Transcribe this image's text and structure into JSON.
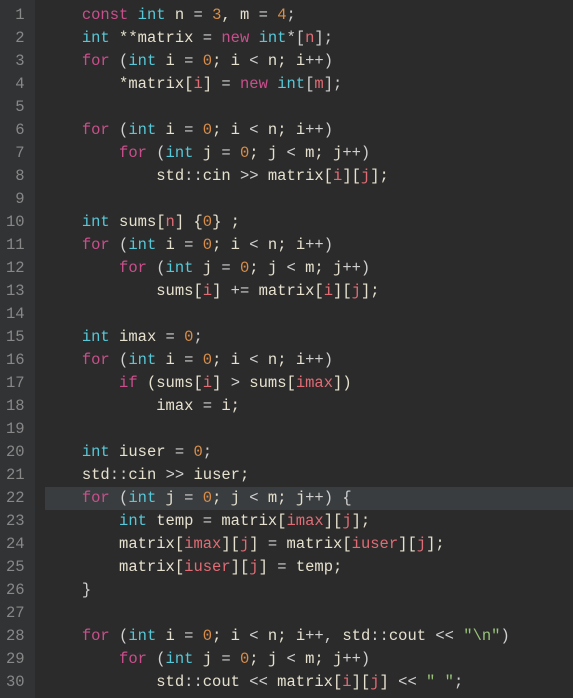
{
  "code": {
    "language": "cpp",
    "line_count": 30,
    "current_line": 22,
    "lines": [
      {
        "n": 1,
        "indent": 1,
        "tokens": [
          {
            "t": "const ",
            "c": "kw"
          },
          {
            "t": "int",
            "c": "type"
          },
          {
            "t": " n ",
            "c": "id"
          },
          {
            "t": "= ",
            "c": "op"
          },
          {
            "t": "3",
            "c": "num"
          },
          {
            "t": ", m ",
            "c": "id"
          },
          {
            "t": "= ",
            "c": "op"
          },
          {
            "t": "4",
            "c": "num"
          },
          {
            "t": ";",
            "c": "op"
          }
        ]
      },
      {
        "n": 2,
        "indent": 1,
        "tokens": [
          {
            "t": "int",
            "c": "type"
          },
          {
            "t": " **matrix ",
            "c": "id"
          },
          {
            "t": "= ",
            "c": "op"
          },
          {
            "t": "new ",
            "c": "kw"
          },
          {
            "t": "int",
            "c": "type"
          },
          {
            "t": "*[",
            "c": "op"
          },
          {
            "t": "n",
            "c": "mid"
          },
          {
            "t": "];",
            "c": "op"
          }
        ]
      },
      {
        "n": 3,
        "indent": 1,
        "tokens": [
          {
            "t": "for",
            "c": "kw"
          },
          {
            "t": " (",
            "c": "op"
          },
          {
            "t": "int",
            "c": "type"
          },
          {
            "t": " i ",
            "c": "id"
          },
          {
            "t": "= ",
            "c": "op"
          },
          {
            "t": "0",
            "c": "num"
          },
          {
            "t": "; i ",
            "c": "id"
          },
          {
            "t": "< ",
            "c": "op"
          },
          {
            "t": "n",
            "c": "id"
          },
          {
            "t": "; i",
            "c": "id"
          },
          {
            "t": "++)",
            "c": "op"
          }
        ]
      },
      {
        "n": 4,
        "indent": 2,
        "tokens": [
          {
            "t": "*matrix[",
            "c": "id"
          },
          {
            "t": "i",
            "c": "mid"
          },
          {
            "t": "] ",
            "c": "id"
          },
          {
            "t": "= ",
            "c": "op"
          },
          {
            "t": "new ",
            "c": "kw"
          },
          {
            "t": "int",
            "c": "type"
          },
          {
            "t": "[",
            "c": "op"
          },
          {
            "t": "m",
            "c": "mid"
          },
          {
            "t": "];",
            "c": "op"
          }
        ]
      },
      {
        "n": 5,
        "indent": 0,
        "tokens": []
      },
      {
        "n": 6,
        "indent": 1,
        "tokens": [
          {
            "t": "for",
            "c": "kw"
          },
          {
            "t": " (",
            "c": "op"
          },
          {
            "t": "int",
            "c": "type"
          },
          {
            "t": " i ",
            "c": "id"
          },
          {
            "t": "= ",
            "c": "op"
          },
          {
            "t": "0",
            "c": "num"
          },
          {
            "t": "; i ",
            "c": "id"
          },
          {
            "t": "< ",
            "c": "op"
          },
          {
            "t": "n",
            "c": "id"
          },
          {
            "t": "; i",
            "c": "id"
          },
          {
            "t": "++)",
            "c": "op"
          }
        ]
      },
      {
        "n": 7,
        "indent": 2,
        "tokens": [
          {
            "t": "for",
            "c": "kw"
          },
          {
            "t": " (",
            "c": "op"
          },
          {
            "t": "int",
            "c": "type"
          },
          {
            "t": " j ",
            "c": "id"
          },
          {
            "t": "= ",
            "c": "op"
          },
          {
            "t": "0",
            "c": "num"
          },
          {
            "t": "; j ",
            "c": "id"
          },
          {
            "t": "< ",
            "c": "op"
          },
          {
            "t": "m",
            "c": "id"
          },
          {
            "t": "; j",
            "c": "id"
          },
          {
            "t": "++)",
            "c": "op"
          }
        ]
      },
      {
        "n": 8,
        "indent": 3,
        "tokens": [
          {
            "t": "std",
            "c": "ns"
          },
          {
            "t": "::",
            "c": "op"
          },
          {
            "t": "cin ",
            "c": "id"
          },
          {
            "t": ">> ",
            "c": "op"
          },
          {
            "t": "matrix[",
            "c": "id"
          },
          {
            "t": "i",
            "c": "mid"
          },
          {
            "t": "][",
            "c": "id"
          },
          {
            "t": "j",
            "c": "mid"
          },
          {
            "t": "];",
            "c": "id"
          }
        ]
      },
      {
        "n": 9,
        "indent": 0,
        "tokens": []
      },
      {
        "n": 10,
        "indent": 1,
        "tokens": [
          {
            "t": "int",
            "c": "type"
          },
          {
            "t": " sums[",
            "c": "id"
          },
          {
            "t": "n",
            "c": "mid"
          },
          {
            "t": "] {",
            "c": "id"
          },
          {
            "t": "0",
            "c": "num"
          },
          {
            "t": "} ;",
            "c": "id"
          }
        ]
      },
      {
        "n": 11,
        "indent": 1,
        "tokens": [
          {
            "t": "for",
            "c": "kw"
          },
          {
            "t": " (",
            "c": "op"
          },
          {
            "t": "int",
            "c": "type"
          },
          {
            "t": " i ",
            "c": "id"
          },
          {
            "t": "= ",
            "c": "op"
          },
          {
            "t": "0",
            "c": "num"
          },
          {
            "t": "; i ",
            "c": "id"
          },
          {
            "t": "< ",
            "c": "op"
          },
          {
            "t": "n",
            "c": "id"
          },
          {
            "t": "; i",
            "c": "id"
          },
          {
            "t": "++)",
            "c": "op"
          }
        ]
      },
      {
        "n": 12,
        "indent": 2,
        "tokens": [
          {
            "t": "for",
            "c": "kw"
          },
          {
            "t": " (",
            "c": "op"
          },
          {
            "t": "int",
            "c": "type"
          },
          {
            "t": " j ",
            "c": "id"
          },
          {
            "t": "= ",
            "c": "op"
          },
          {
            "t": "0",
            "c": "num"
          },
          {
            "t": "; j ",
            "c": "id"
          },
          {
            "t": "< ",
            "c": "op"
          },
          {
            "t": "m",
            "c": "id"
          },
          {
            "t": "; j",
            "c": "id"
          },
          {
            "t": "++)",
            "c": "op"
          }
        ]
      },
      {
        "n": 13,
        "indent": 3,
        "tokens": [
          {
            "t": "sums[",
            "c": "id"
          },
          {
            "t": "i",
            "c": "mid"
          },
          {
            "t": "] ",
            "c": "id"
          },
          {
            "t": "+= ",
            "c": "op"
          },
          {
            "t": "matrix[",
            "c": "id"
          },
          {
            "t": "i",
            "c": "mid"
          },
          {
            "t": "][",
            "c": "id"
          },
          {
            "t": "j",
            "c": "mid"
          },
          {
            "t": "];",
            "c": "id"
          }
        ]
      },
      {
        "n": 14,
        "indent": 0,
        "tokens": []
      },
      {
        "n": 15,
        "indent": 1,
        "tokens": [
          {
            "t": "int",
            "c": "type"
          },
          {
            "t": " imax ",
            "c": "id"
          },
          {
            "t": "= ",
            "c": "op"
          },
          {
            "t": "0",
            "c": "num"
          },
          {
            "t": ";",
            "c": "op"
          }
        ]
      },
      {
        "n": 16,
        "indent": 1,
        "tokens": [
          {
            "t": "for",
            "c": "kw"
          },
          {
            "t": " (",
            "c": "op"
          },
          {
            "t": "int",
            "c": "type"
          },
          {
            "t": " i ",
            "c": "id"
          },
          {
            "t": "= ",
            "c": "op"
          },
          {
            "t": "0",
            "c": "num"
          },
          {
            "t": "; i ",
            "c": "id"
          },
          {
            "t": "< ",
            "c": "op"
          },
          {
            "t": "n",
            "c": "id"
          },
          {
            "t": "; i",
            "c": "id"
          },
          {
            "t": "++)",
            "c": "op"
          }
        ]
      },
      {
        "n": 17,
        "indent": 2,
        "tokens": [
          {
            "t": "if",
            "c": "kw"
          },
          {
            "t": " (sums[",
            "c": "id"
          },
          {
            "t": "i",
            "c": "mid"
          },
          {
            "t": "] ",
            "c": "id"
          },
          {
            "t": "> ",
            "c": "op"
          },
          {
            "t": "sums[",
            "c": "id"
          },
          {
            "t": "imax",
            "c": "mid"
          },
          {
            "t": "])",
            "c": "id"
          }
        ]
      },
      {
        "n": 18,
        "indent": 3,
        "tokens": [
          {
            "t": "imax ",
            "c": "id"
          },
          {
            "t": "= ",
            "c": "op"
          },
          {
            "t": "i;",
            "c": "id"
          }
        ]
      },
      {
        "n": 19,
        "indent": 0,
        "tokens": []
      },
      {
        "n": 20,
        "indent": 1,
        "tokens": [
          {
            "t": "int",
            "c": "type"
          },
          {
            "t": " iuser ",
            "c": "id"
          },
          {
            "t": "= ",
            "c": "op"
          },
          {
            "t": "0",
            "c": "num"
          },
          {
            "t": ";",
            "c": "op"
          }
        ]
      },
      {
        "n": 21,
        "indent": 1,
        "tokens": [
          {
            "t": "std",
            "c": "ns"
          },
          {
            "t": "::",
            "c": "op"
          },
          {
            "t": "cin ",
            "c": "id"
          },
          {
            "t": ">> ",
            "c": "op"
          },
          {
            "t": "iuser;",
            "c": "id"
          }
        ]
      },
      {
        "n": 22,
        "indent": 1,
        "tokens": [
          {
            "t": "for",
            "c": "kw"
          },
          {
            "t": " (",
            "c": "op"
          },
          {
            "t": "int",
            "c": "type"
          },
          {
            "t": " j ",
            "c": "id"
          },
          {
            "t": "= ",
            "c": "op"
          },
          {
            "t": "0",
            "c": "num"
          },
          {
            "t": "; j ",
            "c": "id"
          },
          {
            "t": "< ",
            "c": "op"
          },
          {
            "t": "m",
            "c": "id"
          },
          {
            "t": "; j",
            "c": "id"
          },
          {
            "t": "++) {",
            "c": "op"
          }
        ]
      },
      {
        "n": 23,
        "indent": 2,
        "tokens": [
          {
            "t": "int",
            "c": "type"
          },
          {
            "t": " temp ",
            "c": "id"
          },
          {
            "t": "= ",
            "c": "op"
          },
          {
            "t": "matrix[",
            "c": "id"
          },
          {
            "t": "imax",
            "c": "mid"
          },
          {
            "t": "][",
            "c": "id"
          },
          {
            "t": "j",
            "c": "mid"
          },
          {
            "t": "];",
            "c": "id"
          }
        ]
      },
      {
        "n": 24,
        "indent": 2,
        "tokens": [
          {
            "t": "matrix[",
            "c": "id"
          },
          {
            "t": "imax",
            "c": "mid"
          },
          {
            "t": "][",
            "c": "id"
          },
          {
            "t": "j",
            "c": "mid"
          },
          {
            "t": "] ",
            "c": "id"
          },
          {
            "t": "= ",
            "c": "op"
          },
          {
            "t": "matrix[",
            "c": "id"
          },
          {
            "t": "iuser",
            "c": "mid"
          },
          {
            "t": "][",
            "c": "id"
          },
          {
            "t": "j",
            "c": "mid"
          },
          {
            "t": "];",
            "c": "id"
          }
        ]
      },
      {
        "n": 25,
        "indent": 2,
        "tokens": [
          {
            "t": "matrix[",
            "c": "id"
          },
          {
            "t": "iuser",
            "c": "mid"
          },
          {
            "t": "][",
            "c": "id"
          },
          {
            "t": "j",
            "c": "mid"
          },
          {
            "t": "] ",
            "c": "id"
          },
          {
            "t": "= ",
            "c": "op"
          },
          {
            "t": "temp;",
            "c": "id"
          }
        ]
      },
      {
        "n": 26,
        "indent": 1,
        "tokens": [
          {
            "t": "}",
            "c": "op"
          }
        ]
      },
      {
        "n": 27,
        "indent": 0,
        "tokens": []
      },
      {
        "n": 28,
        "indent": 1,
        "tokens": [
          {
            "t": "for",
            "c": "kw"
          },
          {
            "t": " (",
            "c": "op"
          },
          {
            "t": "int",
            "c": "type"
          },
          {
            "t": " i ",
            "c": "id"
          },
          {
            "t": "= ",
            "c": "op"
          },
          {
            "t": "0",
            "c": "num"
          },
          {
            "t": "; i ",
            "c": "id"
          },
          {
            "t": "< ",
            "c": "op"
          },
          {
            "t": "n",
            "c": "id"
          },
          {
            "t": "; i",
            "c": "id"
          },
          {
            "t": "++, ",
            "c": "op"
          },
          {
            "t": "std",
            "c": "ns"
          },
          {
            "t": "::",
            "c": "op"
          },
          {
            "t": "cout ",
            "c": "id"
          },
          {
            "t": "<< ",
            "c": "op"
          },
          {
            "t": "\"\\n\"",
            "c": "str"
          },
          {
            "t": ")",
            "c": "op"
          }
        ]
      },
      {
        "n": 29,
        "indent": 2,
        "tokens": [
          {
            "t": "for",
            "c": "kw"
          },
          {
            "t": " (",
            "c": "op"
          },
          {
            "t": "int",
            "c": "type"
          },
          {
            "t": " j ",
            "c": "id"
          },
          {
            "t": "= ",
            "c": "op"
          },
          {
            "t": "0",
            "c": "num"
          },
          {
            "t": "; j ",
            "c": "id"
          },
          {
            "t": "< ",
            "c": "op"
          },
          {
            "t": "m",
            "c": "id"
          },
          {
            "t": "; j",
            "c": "id"
          },
          {
            "t": "++)",
            "c": "op"
          }
        ]
      },
      {
        "n": 30,
        "indent": 3,
        "tokens": [
          {
            "t": "std",
            "c": "ns"
          },
          {
            "t": "::",
            "c": "op"
          },
          {
            "t": "cout ",
            "c": "id"
          },
          {
            "t": "<< ",
            "c": "op"
          },
          {
            "t": "matrix[",
            "c": "id"
          },
          {
            "t": "i",
            "c": "mid"
          },
          {
            "t": "][",
            "c": "id"
          },
          {
            "t": "j",
            "c": "mid"
          },
          {
            "t": "] ",
            "c": "id"
          },
          {
            "t": "<< ",
            "c": "op"
          },
          {
            "t": "\" \"",
            "c": "str"
          },
          {
            "t": ";",
            "c": "op"
          }
        ]
      }
    ]
  }
}
